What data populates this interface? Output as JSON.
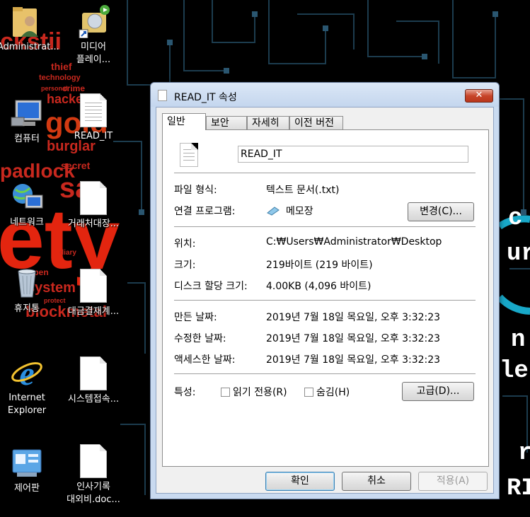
{
  "wallpaper": {
    "words": [
      "ckstii",
      "thief",
      "technology",
      "personal",
      "crime",
      "hackers",
      "gold",
      "burglar",
      "padlock",
      "secret",
      "sa",
      "ety",
      "open",
      "system",
      "protect",
      "blockmetal",
      "diary",
      "c",
      "ur",
      "n",
      "le",
      "r",
      "RI"
    ]
  },
  "desktop": {
    "icons": [
      {
        "label": "Administrat...",
        "icon": "user-folder-icon"
      },
      {
        "label": "미디어\n플레이...",
        "icon": "media-player-icon"
      },
      {
        "label": "컴퓨터",
        "icon": "computer-icon"
      },
      {
        "label": "READ_IT",
        "icon": "text-file-icon"
      },
      {
        "label": "네트워크",
        "icon": "network-icon"
      },
      {
        "label": "거래처대장...",
        "icon": "file-icon"
      },
      {
        "label": "휴지통",
        "icon": "recycle-bin-icon"
      },
      {
        "label": "대금결재계...",
        "icon": "file-icon"
      },
      {
        "label": "Internet\nExplorer",
        "icon": "internet-explorer-icon"
      },
      {
        "label": "시스템접속...",
        "icon": "file-icon"
      },
      {
        "label": "제어판",
        "icon": "control-panel-icon"
      },
      {
        "label": "인사기록\n대외비.doc...",
        "icon": "file-icon"
      }
    ]
  },
  "dialog": {
    "title": "READ_IT 속성",
    "close_label": "✕",
    "tabs": [
      {
        "label": "일반"
      },
      {
        "label": "보안"
      },
      {
        "label": "자세히"
      },
      {
        "label": "이전 버전"
      }
    ],
    "file_name": "READ_IT",
    "file_type_label": "파일 형식:",
    "file_type_value": "텍스트 문서(.txt)",
    "opens_with_label": "연결 프로그램:",
    "opens_with_value": "메모장",
    "change_button": "변경(C)...",
    "location_label": "위치:",
    "location_value": "C:₩Users₩Administrator₩Desktop",
    "size_label": "크기:",
    "size_value": "219바이트 (219 바이트)",
    "disk_size_label": "디스크 할당 크기:",
    "disk_size_value": "4.00KB (4,096 바이트)",
    "created_label": "만든 날짜:",
    "created_value": "2019년 7월 18일 목요일, 오후 3:32:23",
    "modified_label": "수정한 날짜:",
    "modified_value": "2019년 7월 18일 목요일, 오후 3:32:23",
    "accessed_label": "액세스한 날짜:",
    "accessed_value": "2019년 7월 18일 목요일, 오후 3:32:23",
    "attributes_label": "특성:",
    "readonly_label": "읽기 전용(R)",
    "hidden_label": "숨김(H)",
    "advanced_button": "고급(D)...",
    "ok_button": "확인",
    "cancel_button": "취소",
    "apply_button": "적용(A)"
  }
}
